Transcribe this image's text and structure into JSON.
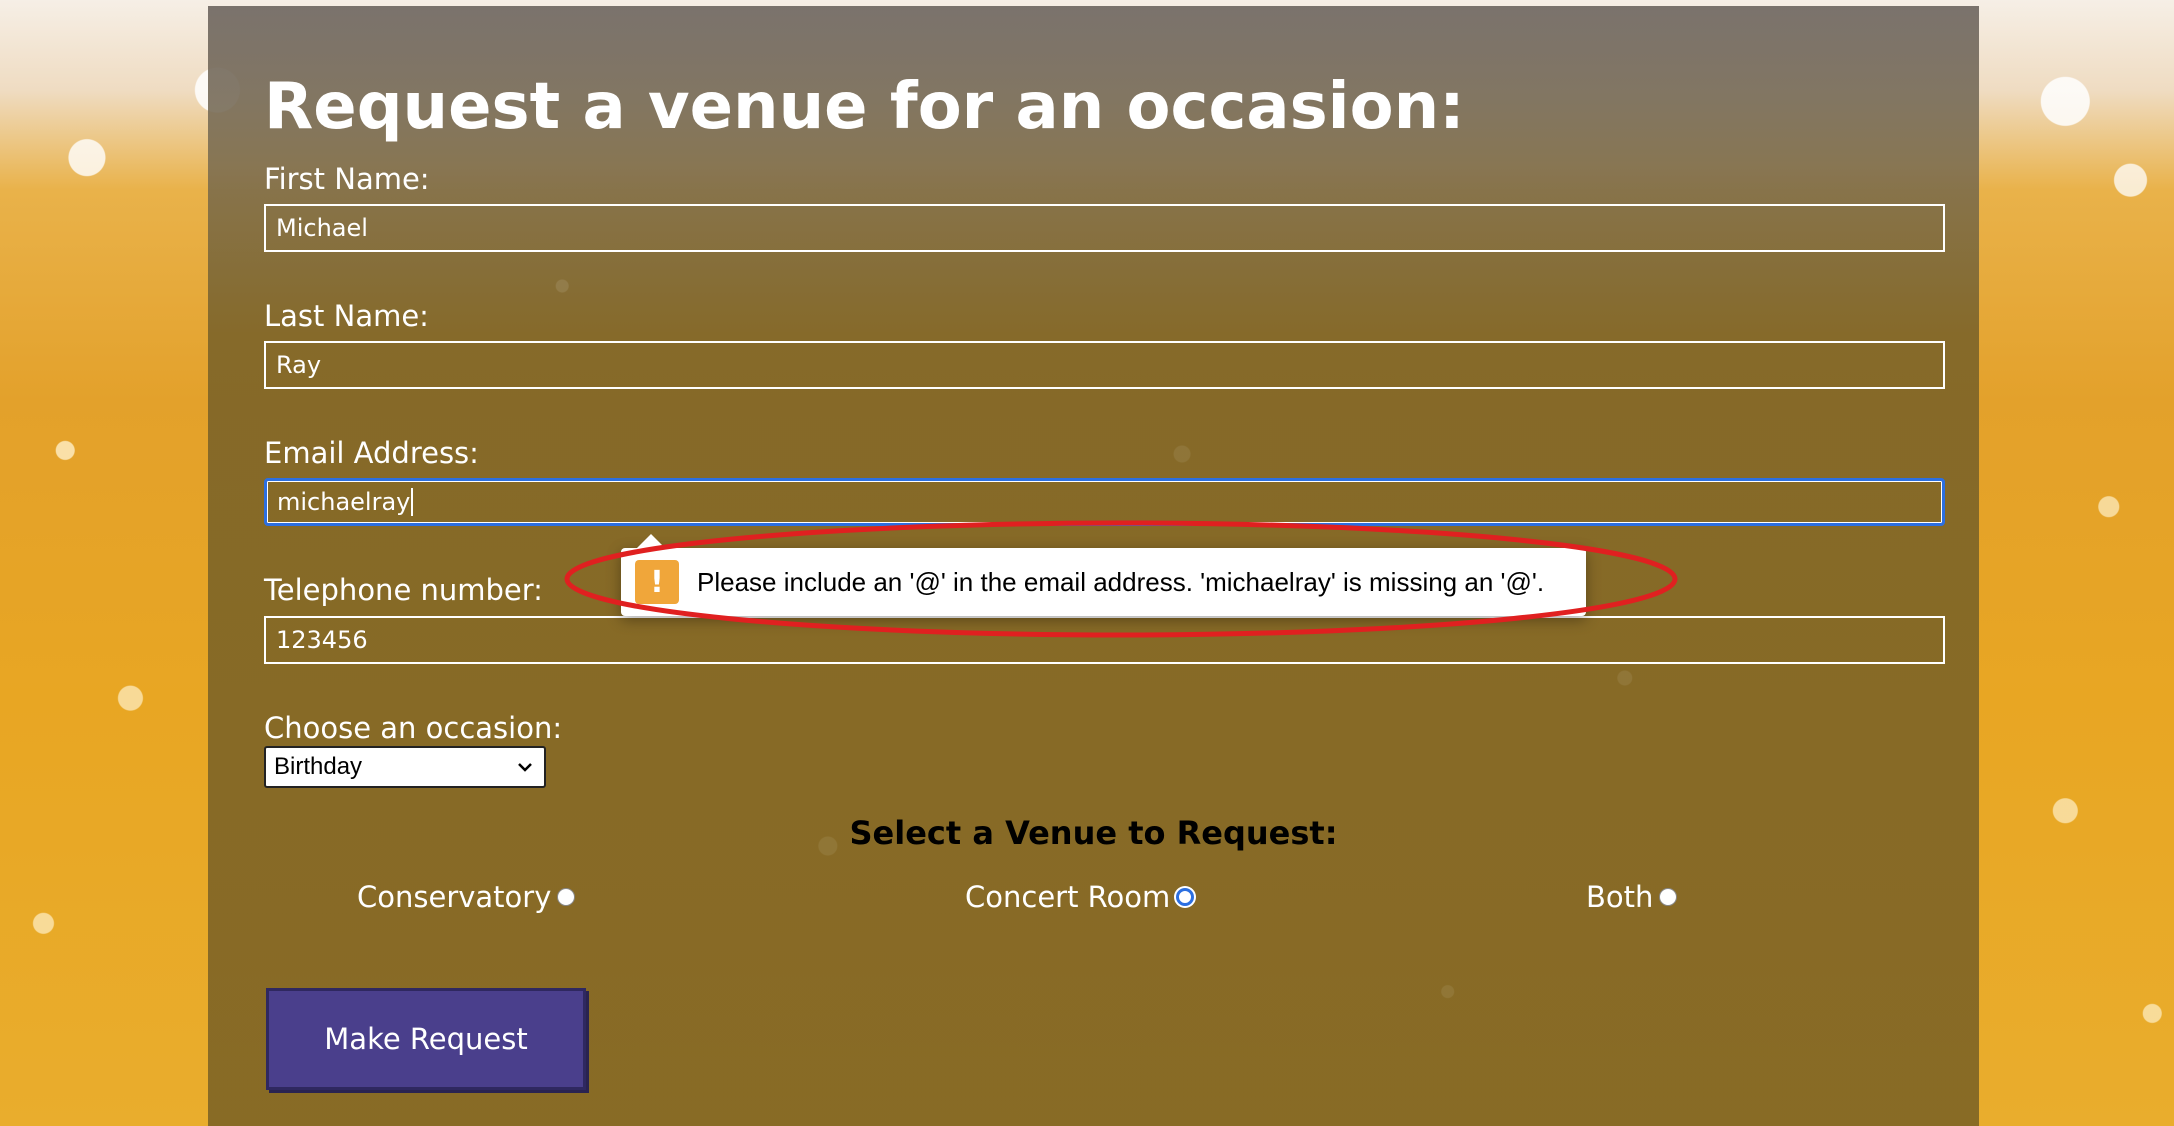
{
  "form": {
    "title": "Request a venue for an occasion:",
    "first_name": {
      "label": "First Name:",
      "value": "Michael"
    },
    "last_name": {
      "label": "Last Name:",
      "value": "Ray"
    },
    "email": {
      "label": "Email Address:",
      "value": "michaelray"
    },
    "telephone": {
      "label": "Telephone number:",
      "value": "123456"
    },
    "occasion": {
      "label": "Choose an occasion:",
      "selected": "Birthday"
    },
    "venue": {
      "heading": "Select a Venue to Request:",
      "options": [
        {
          "label": "Conservatory",
          "selected": false
        },
        {
          "label": "Concert Room",
          "selected": true
        },
        {
          "label": "Both",
          "selected": false
        }
      ]
    },
    "submit_label": "Make Request"
  },
  "validation": {
    "message": "Please include an '@' in the email address. 'michaelray' is missing an '@'.",
    "icon": "warning-icon",
    "icon_glyph": "!",
    "icon_color": "#f0a63a"
  },
  "annotation": {
    "icon": "highlight-ellipse",
    "color": "#e02020"
  },
  "colors": {
    "focus_ring": "#2c6fe0",
    "button": "#4a3f8c"
  }
}
